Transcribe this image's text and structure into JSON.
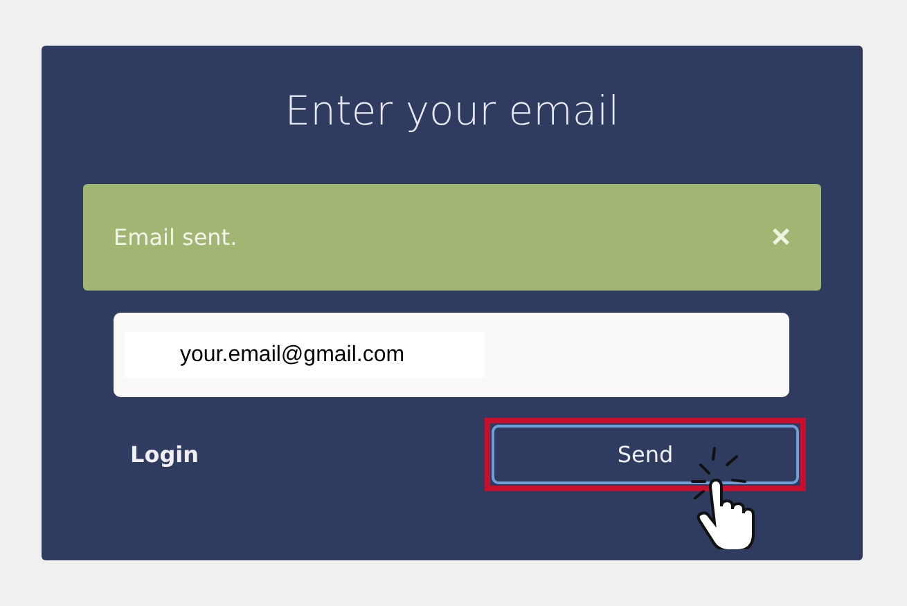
{
  "title": "Enter your email",
  "alert": {
    "message": "Email sent.",
    "close": "×"
  },
  "email_field": {
    "value": "your.email@gmail.com"
  },
  "login_link": "Login",
  "send_button": {
    "label": "Send",
    "highlighted": true
  }
}
